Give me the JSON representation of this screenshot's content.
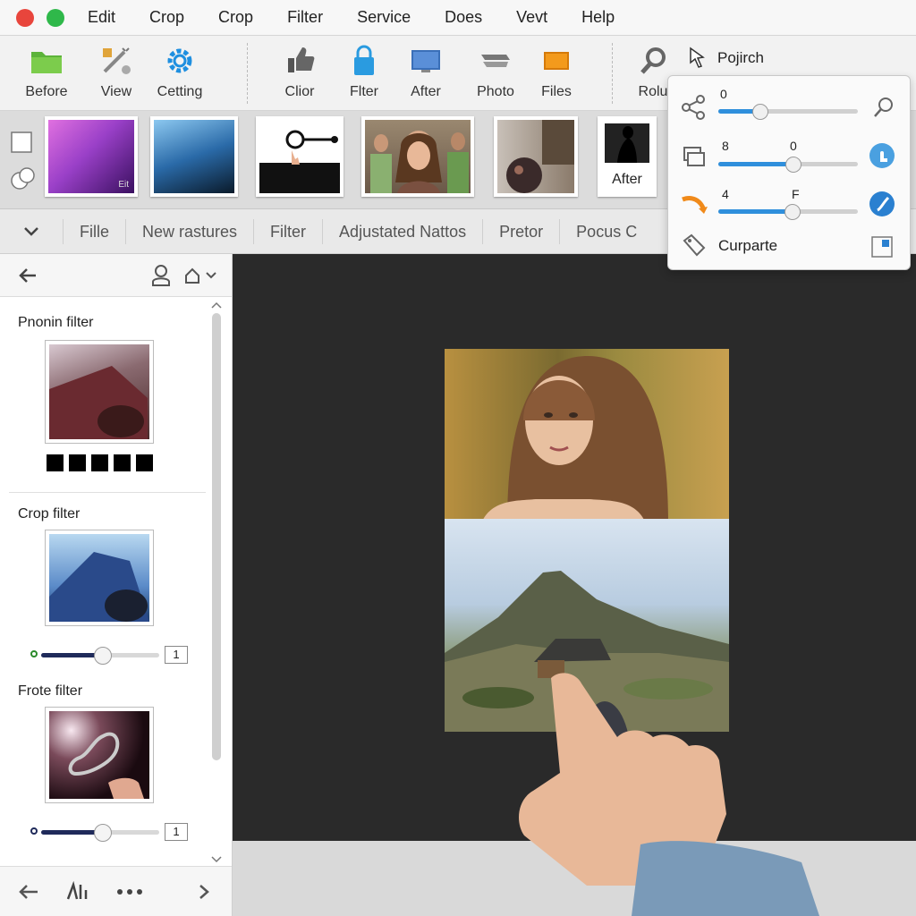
{
  "menubar": {
    "items": [
      "Edit",
      "Crop",
      "Crop",
      "Filter",
      "Service",
      "Does",
      "Vevt",
      "Help"
    ]
  },
  "toolbar": {
    "group1": [
      {
        "label": "Before",
        "icon": "folder-icon"
      },
      {
        "label": "View",
        "icon": "magic-wand-icon"
      },
      {
        "label": "Cetting",
        "icon": "gear-icon"
      }
    ],
    "group2": [
      {
        "label": "Clior",
        "icon": "thumbs-up-icon"
      },
      {
        "label": "Flter",
        "icon": "lock-icon"
      },
      {
        "label": "After",
        "icon": "monitor-icon"
      },
      {
        "label": "Photo",
        "icon": "layers-icon"
      },
      {
        "label": "Files",
        "icon": "orange-square-icon"
      }
    ],
    "search_label": "Rolu",
    "pointer_label": "Pojirch"
  },
  "thumbstrip": {
    "gradient_badge": "Eit",
    "after_label": "After"
  },
  "tabs": [
    "Fille",
    "New rastures",
    "Filter",
    "Adjustated Nattos",
    "Pretor",
    "Pocus C"
  ],
  "left_panel": {
    "filters": [
      {
        "title": "Pnonin filter"
      },
      {
        "title": "Crop filter",
        "slider_value": "1",
        "slider_level": 0.52
      },
      {
        "title": "Frote filter",
        "slider_value": "1",
        "slider_level": 0.52
      }
    ]
  },
  "popover": {
    "row1": {
      "value": "0",
      "level": 0.3
    },
    "row2": {
      "value_left": "8",
      "value_right": "0",
      "level": 0.54
    },
    "row3": {
      "value_left": "4",
      "value_right": "F",
      "level": 0.53
    },
    "footer_label": "Curparte"
  },
  "colors": {
    "accent_blue": "#2f8fdc",
    "slider_navy": "#1f2a5a",
    "canvas_bg": "#2a2a2a"
  }
}
